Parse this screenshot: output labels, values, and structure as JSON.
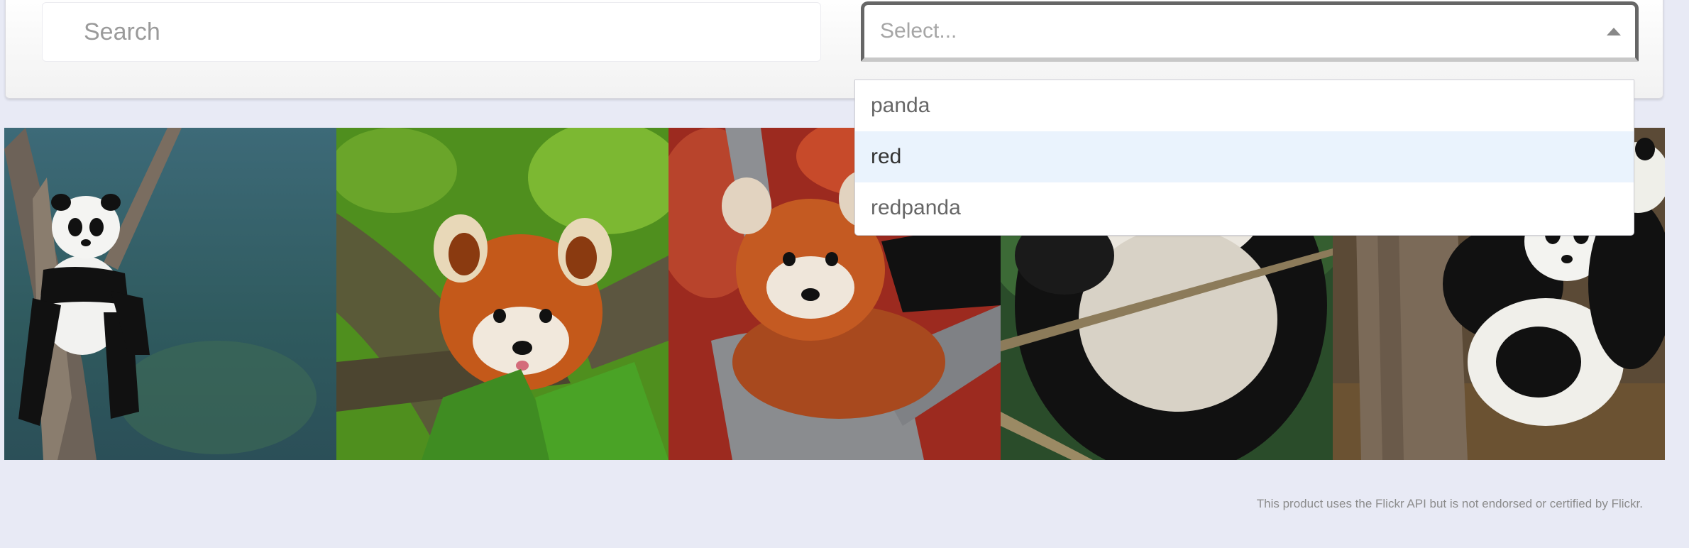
{
  "search": {
    "placeholder": "Search",
    "value": ""
  },
  "select": {
    "placeholder": "Select...",
    "arrow_icon": "triangle-up-icon",
    "open": true,
    "options": [
      "panda",
      "red",
      "redpanda"
    ],
    "focused_option": "red"
  },
  "gallery": {
    "photos": [
      {
        "subject": "giant panda hanging on a tree branch"
      },
      {
        "subject": "red panda peeking through green leaves"
      },
      {
        "subject": "red panda curled on a tree fork"
      },
      {
        "subject": "giant panda eating bamboo"
      },
      {
        "subject": "group of giant panda cubs by a tree"
      }
    ]
  },
  "footer": {
    "text": "This product uses the Flickr API but is not endorsed or certified by Flickr."
  },
  "colors": {
    "page_bg": "#e8eaf5",
    "option_highlight": "#eaf3fd",
    "select_border": "#666666"
  }
}
